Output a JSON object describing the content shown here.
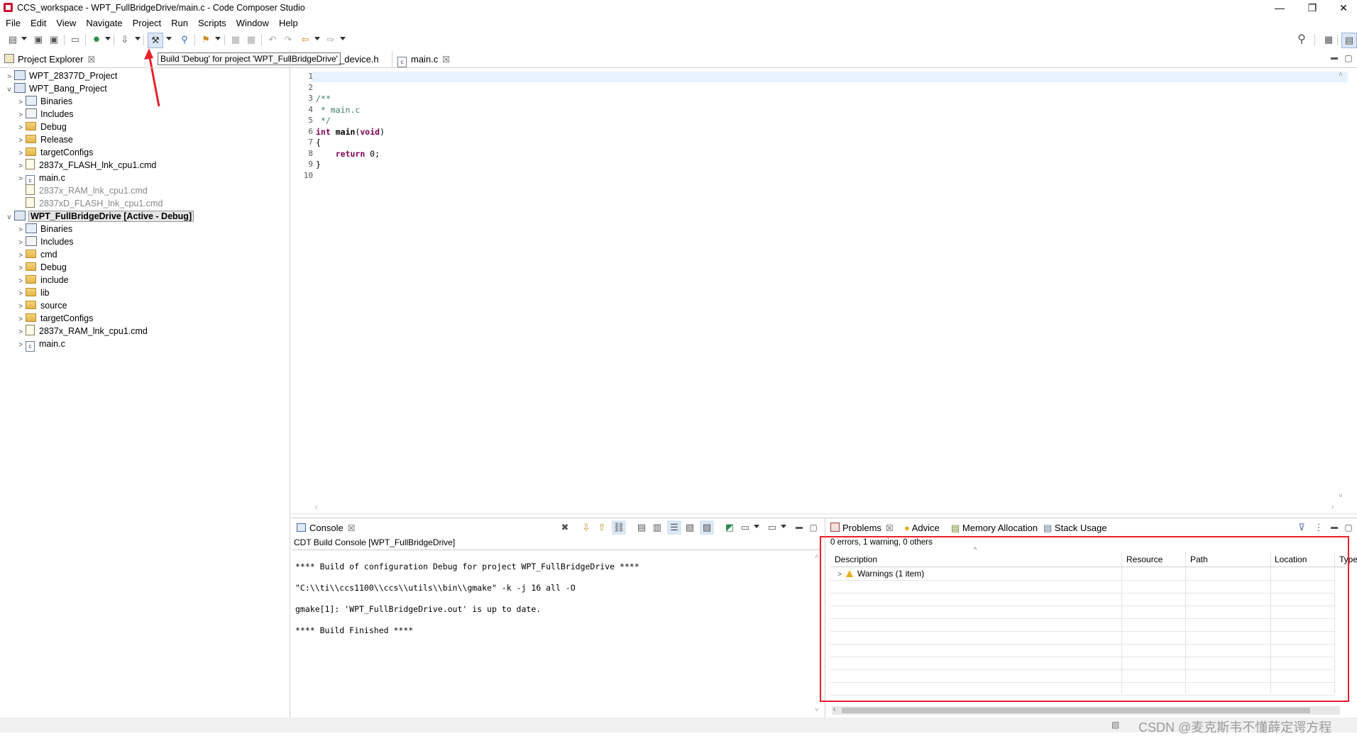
{
  "window": {
    "title": "CCS_workspace - WPT_FullBridgeDrive/main.c - Code Composer Studio",
    "controls": [
      "—",
      "❐",
      "✕"
    ]
  },
  "menubar": [
    "File",
    "Edit",
    "View",
    "Navigate",
    "Project",
    "Run",
    "Scripts",
    "Window",
    "Help"
  ],
  "tooltip": "Build 'Debug' for project 'WPT_FullBridgeDrive'",
  "project_explorer": {
    "tab_label": "Project Explorer",
    "items": [
      {
        "label": "WPT_28377D_Project",
        "level": 0,
        "type": "project",
        "chev": ">"
      },
      {
        "label": "WPT_Bang_Project",
        "level": 0,
        "type": "project",
        "chev": "v"
      },
      {
        "label": "Binaries",
        "level": 1,
        "type": "binaries",
        "chev": ">"
      },
      {
        "label": "Includes",
        "level": 1,
        "type": "includes",
        "chev": ">"
      },
      {
        "label": "Debug",
        "level": 1,
        "type": "folder",
        "chev": ">"
      },
      {
        "label": "Release",
        "level": 1,
        "type": "folder",
        "chev": ">"
      },
      {
        "label": "targetConfigs",
        "level": 1,
        "type": "folder",
        "chev": ">"
      },
      {
        "label": "2837x_FLASH_lnk_cpu1.cmd",
        "level": 1,
        "type": "cmd",
        "chev": ">"
      },
      {
        "label": "main.c",
        "level": 1,
        "type": "c",
        "chev": ">"
      },
      {
        "label": "2837x_RAM_lnk_cpu1.cmd",
        "level": 1,
        "type": "cmd-gray",
        "chev": ""
      },
      {
        "label": "2837xD_FLASH_lnk_cpu1.cmd",
        "level": 1,
        "type": "cmd-gray",
        "chev": ""
      },
      {
        "label": "WPT_FullBridgeDrive  [Active - Debug]",
        "level": 0,
        "type": "project-active",
        "chev": "v"
      },
      {
        "label": "Binaries",
        "level": 1,
        "type": "binaries",
        "chev": ">"
      },
      {
        "label": "Includes",
        "level": 1,
        "type": "includes",
        "chev": ">"
      },
      {
        "label": "cmd",
        "level": 1,
        "type": "folder",
        "chev": ">"
      },
      {
        "label": "Debug",
        "level": 1,
        "type": "folder",
        "chev": ">"
      },
      {
        "label": "include",
        "level": 1,
        "type": "folder",
        "chev": ">"
      },
      {
        "label": "lib",
        "level": 1,
        "type": "folder",
        "chev": ">"
      },
      {
        "label": "source",
        "level": 1,
        "type": "folder",
        "chev": ">"
      },
      {
        "label": "targetConfigs",
        "level": 1,
        "type": "folder",
        "chev": ">"
      },
      {
        "label": "2837x_RAM_lnk_cpu1.cmd",
        "level": 1,
        "type": "cmd",
        "chev": ">"
      },
      {
        "label": "main.c",
        "level": 1,
        "type": "c",
        "chev": ">"
      }
    ]
  },
  "editor": {
    "tabs": [
      {
        "label": "_device.h"
      },
      {
        "label": "main.c"
      }
    ],
    "lines": [
      {
        "num": "1",
        "text": ""
      },
      {
        "num": "2",
        "text": ""
      },
      {
        "num": "3",
        "text": "/**"
      },
      {
        "num": "4",
        "text": " * main.c"
      },
      {
        "num": "5",
        "text": " */"
      },
      {
        "num": "6",
        "text": "int main(void)"
      },
      {
        "num": "7",
        "text": "{"
      },
      {
        "num": "8",
        "text": "    return 0;"
      },
      {
        "num": "9",
        "text": "}"
      },
      {
        "num": "10",
        "text": ""
      }
    ]
  },
  "console": {
    "tab_label": "Console",
    "title": "CDT Build Console [WPT_FullBridgeDrive]",
    "lines": [
      "**** Build of configuration Debug for project WPT_FullBridgeDrive ****",
      "\"C:\\\\ti\\\\ccs1100\\\\ccs\\\\utils\\\\bin\\\\gmake\" -k -j 16 all -O",
      "gmake[1]: 'WPT_FullBridgeDrive.out' is up to date.",
      "**** Build Finished ****"
    ]
  },
  "problems": {
    "tabs": [
      "Problems",
      "Advice",
      "Memory Allocation",
      "Stack Usage"
    ],
    "summary": "0 errors, 1 warning, 0 others",
    "columns": [
      "Description",
      "Resource",
      "Path",
      "Location",
      "Type"
    ],
    "rows": [
      {
        "description": "Warnings (1 item)"
      }
    ]
  },
  "status_bar": {
    "watermark": "CSDN @麦克斯韦不懂薛定谔方程"
  },
  "colors": {
    "highlight_red": "#e8202a",
    "keyword": "#7f0055",
    "comment": "#3f7f5f",
    "current_line": "#e8f2fe"
  }
}
